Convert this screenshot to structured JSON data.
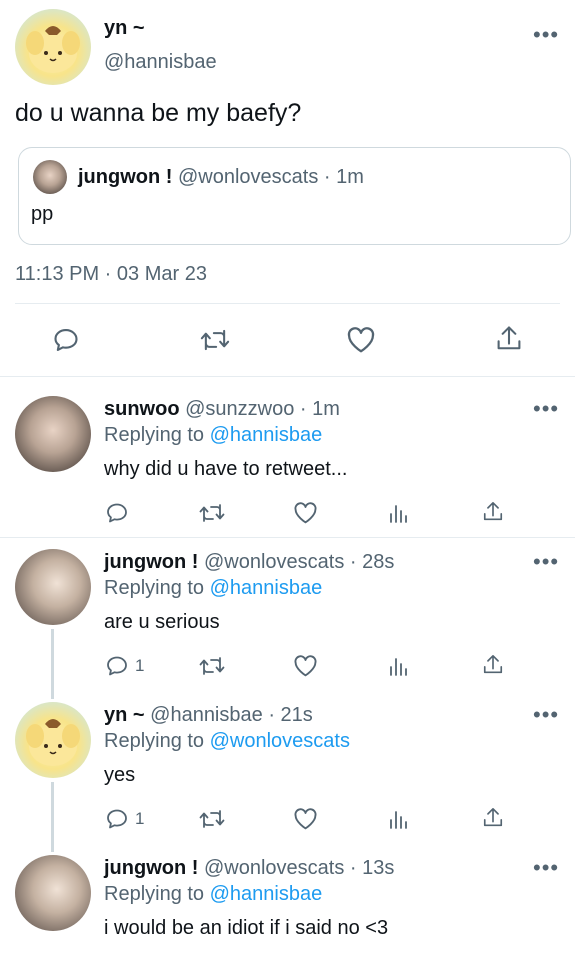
{
  "main_tweet": {
    "name": "yn ~",
    "handle": "@hannisbae",
    "text": "do u wanna be my baefy?",
    "quote": {
      "name": "jungwon !",
      "handle": "@wonlovescats",
      "time": "· 1m",
      "text": "pp"
    },
    "timestamp": "11:13 PM · 03 Mar 23"
  },
  "more_glyph": "•••",
  "replies": [
    {
      "name": "sunwoo",
      "handle": "@sunzzwoo",
      "time": "· 1m",
      "replying_prefix": "Replying to ",
      "replying_to": "@hannisbae",
      "text": "why did u have to retweet...",
      "reply_count": ""
    },
    {
      "name": "jungwon !",
      "handle": "@wonlovescats",
      "time": "· 28s",
      "replying_prefix": "Replying to ",
      "replying_to": "@hannisbae",
      "text": "are u serious",
      "reply_count": "1"
    },
    {
      "name": "yn ~",
      "handle": "@hannisbae",
      "time": "· 21s",
      "replying_prefix": "Replying to ",
      "replying_to": "@wonlovescats",
      "text": "yes",
      "reply_count": "1"
    },
    {
      "name": "jungwon !",
      "handle": "@wonlovescats",
      "time": "· 13s",
      "replying_prefix": "Replying to ",
      "replying_to": "@hannisbae",
      "text": "i would be an idiot if i said no <3"
    }
  ],
  "icons": {
    "reply": "reply-icon",
    "retweet": "retweet-icon",
    "like": "like-icon",
    "views": "views-icon",
    "share": "share-icon",
    "more": "more-icon"
  },
  "colors": {
    "link": "#1d9bf0",
    "secondary_text": "#536471",
    "border": "#cfd9de"
  }
}
